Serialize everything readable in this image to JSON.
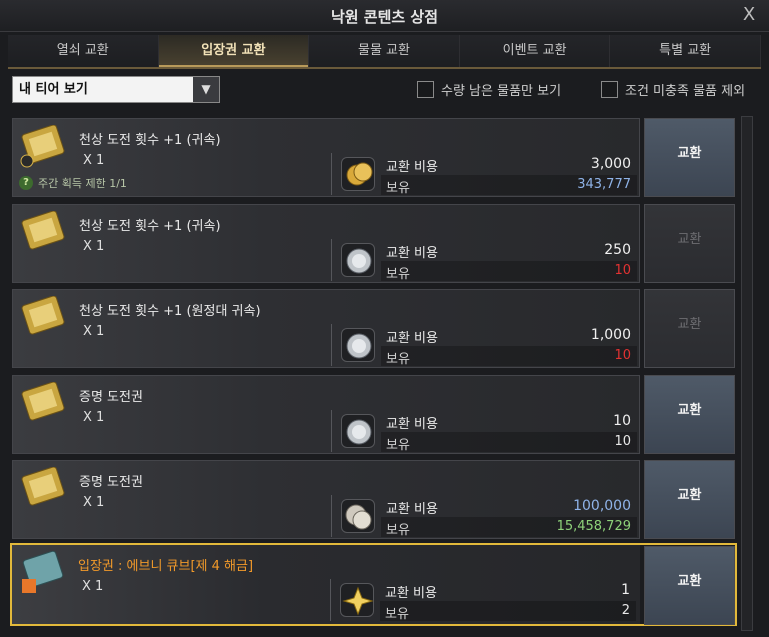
{
  "window": {
    "title": "낙원 콘텐츠 상점",
    "close_label": "X"
  },
  "tabs": [
    {
      "label": "열쇠 교환",
      "active": false
    },
    {
      "label": "입장권 교환",
      "active": true
    },
    {
      "label": "물물 교환",
      "active": false
    },
    {
      "label": "이벤트 교환",
      "active": false
    },
    {
      "label": "특별 교환",
      "active": false
    }
  ],
  "filters": {
    "tier_select": "내 티어 보기",
    "checkbox_stock": "수량 남은 물품만 보기",
    "checkbox_condition": "조건 미충족 물품 제외"
  },
  "labels": {
    "cost": "교환 비용",
    "owned": "보유",
    "exchange": "교환"
  },
  "items": [
    {
      "name": "천상 도전 횟수 +1 (귀속)",
      "qty": "X 1",
      "limit": "주간 획득 제한 1/1",
      "currency_icon": "gold-coin-icon",
      "cost": "3,000",
      "owned": "343,777",
      "owned_color": "blue",
      "enabled": true
    },
    {
      "name": "천상 도전 횟수 +1 (귀속)",
      "qty": "X 1",
      "limit": "",
      "currency_icon": "silver-medal-icon",
      "cost": "250",
      "owned": "10",
      "owned_color": "red",
      "enabled": false
    },
    {
      "name": "천상 도전 횟수 +1 (원정대 귀속)",
      "qty": "X 1",
      "limit": "",
      "currency_icon": "silver-medal-icon",
      "cost": "1,000",
      "owned": "10",
      "owned_color": "red",
      "enabled": false
    },
    {
      "name": "증명 도전권",
      "qty": "X 1",
      "limit": "",
      "currency_icon": "silver-medal-icon",
      "cost": "10",
      "owned": "10",
      "owned_color": "white",
      "enabled": true
    },
    {
      "name": "증명 도전권",
      "qty": "X 1",
      "limit": "",
      "currency_icon": "silver-coin-icon",
      "cost": "100,000",
      "owned": "15,458,729",
      "owned_color": "green",
      "cost_color": "blue",
      "enabled": true
    },
    {
      "name": "입장권 : 에브니 큐브[제 4 해금]",
      "qty": "X 1",
      "limit": "",
      "currency_icon": "star-crystal-icon",
      "cost": "1",
      "owned": "2",
      "owned_color": "white",
      "enabled": true,
      "highlight": true
    }
  ],
  "colors": {
    "highlight_border": "#e2b93b",
    "active_tab_text": "#f2e2b8",
    "enabled_button": "#4f5a68"
  }
}
